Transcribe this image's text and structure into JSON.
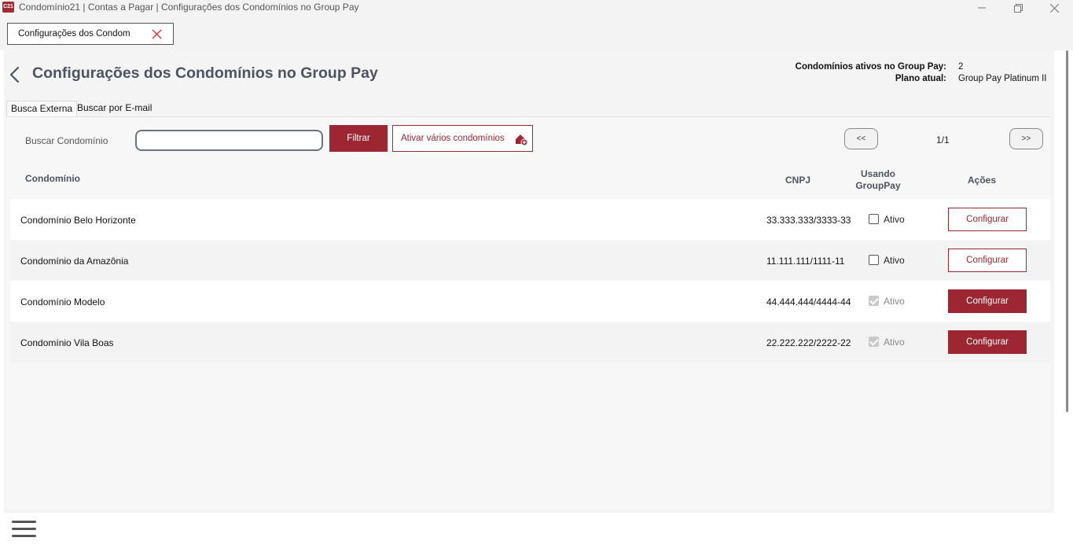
{
  "window": {
    "icon_text": "C21",
    "title": "Condomínio21 | Contas a Pagar | Configurações dos Condomínios no Group Pay"
  },
  "open_tab": {
    "label": "Configurações dos Condom"
  },
  "page": {
    "title": "Configurações dos Condomínios no Group Pay",
    "active_label": "Condomínios ativos no Group Pay:",
    "active_value": "2",
    "plan_label": "Plano atual:",
    "plan_value": "Group Pay Platinum II"
  },
  "search_tabs": [
    "Busca Externa",
    "Buscar por E-mail"
  ],
  "search": {
    "label": "Buscar Condomínio",
    "value": "",
    "filter_button": "Filtrar",
    "activate_button": "Ativar vários condomínios"
  },
  "pager": {
    "prev": "<<",
    "info": "1/1",
    "next": ">>"
  },
  "table": {
    "headers": {
      "name": "Condomínio",
      "cnpj": "CNPJ",
      "using_line1": "Usando",
      "using_line2": "GroupPay",
      "actions": "Ações"
    },
    "rows": [
      {
        "name": "Condomínio Belo Horizonte",
        "cnpj": "33.333.333/3333-33",
        "status_label": "Ativo",
        "active": false,
        "action": "Configurar"
      },
      {
        "name": "Condomínio da Amazônia",
        "cnpj": "11.111.111/1111-11",
        "status_label": "Ativo",
        "active": false,
        "action": "Configurar"
      },
      {
        "name": "Condomínio Modelo",
        "cnpj": "44.444.444/4444-44",
        "status_label": "Ativo",
        "active": true,
        "action": "Configurar"
      },
      {
        "name": "Condomínio Vila Boas",
        "cnpj": "22.222.222/2222-22",
        "status_label": "Ativo",
        "active": true,
        "action": "Configurar"
      }
    ]
  },
  "colors": {
    "accent": "#9c2631",
    "title_text": "#4c5361"
  }
}
